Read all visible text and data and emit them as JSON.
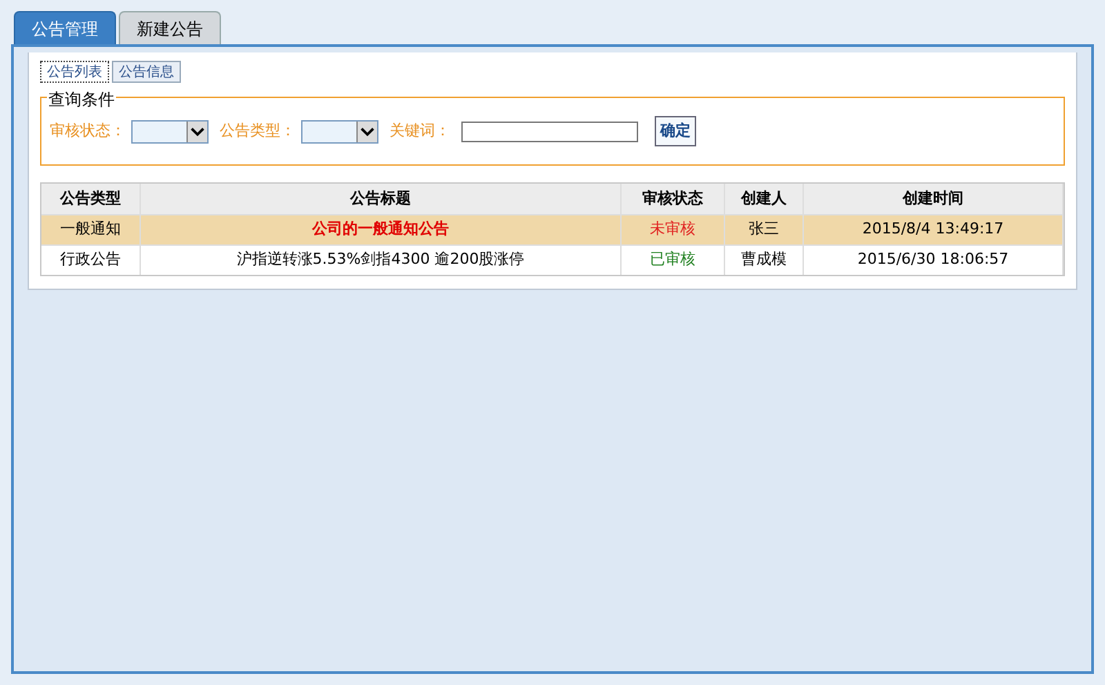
{
  "tabs": [
    {
      "label": "公告管理",
      "selected": true
    },
    {
      "label": "新建公告",
      "selected": false
    }
  ],
  "sub_tabs": [
    {
      "label": "公告列表",
      "selected": true
    },
    {
      "label": "公告信息",
      "selected": false
    }
  ],
  "filter": {
    "legend": "查询条件",
    "fields": [
      {
        "kind": "select",
        "label": "审核状态："
      },
      {
        "kind": "select",
        "label": "公告类型："
      },
      {
        "kind": "text",
        "label": "关键词："
      }
    ],
    "button": "确定"
  },
  "table": {
    "columns": [
      "公告类型",
      "公告标题",
      "审核状态",
      "创建人",
      "创建时间"
    ],
    "rows": [
      {
        "selected": true,
        "type": "一般通知",
        "title": "公司的一般通知公告",
        "status": "未审核",
        "approved": false,
        "creator": "张三",
        "created": "2015/8/4 13:49:17"
      },
      {
        "selected": false,
        "type": "行政公告",
        "title": "沪指逆转涨5.53%剑指4300 逾200股涨停",
        "status": "已审核",
        "approved": true,
        "creator": "曹成模",
        "created": "2015/6/30 18:06:57"
      }
    ]
  }
}
